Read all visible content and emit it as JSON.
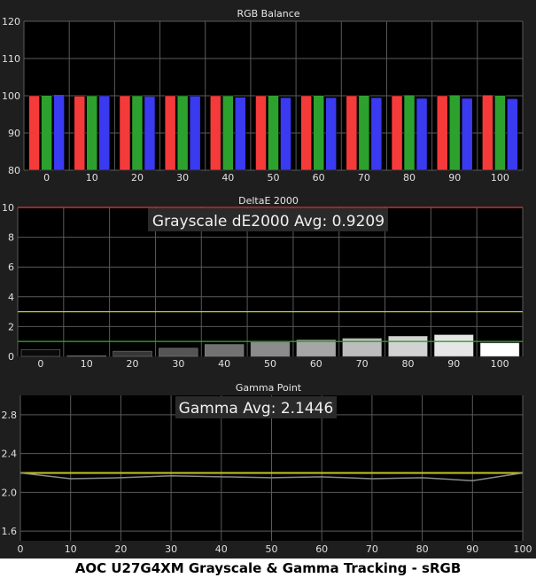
{
  "caption": "AOC U27G4XM Grayscale & Gamma Tracking - sRGB",
  "colors": {
    "red": "#f53a3a",
    "green": "#2da12d",
    "blue": "#3a3af0",
    "redline": "#e23a3a",
    "yellow": "#c8c81e",
    "greenline": "#2aa12a",
    "gamma_target": "#c8c81e",
    "gamma_measured": "#8a8a8a"
  },
  "chart_data": [
    {
      "type": "bar",
      "title": "RGB Balance",
      "categories": [
        "0",
        "10",
        "20",
        "30",
        "40",
        "50",
        "60",
        "70",
        "80",
        "90",
        "100"
      ],
      "series": [
        {
          "color": "red",
          "values": [
            100.0,
            99.9,
            100.0,
            100.0,
            100.0,
            100.0,
            100.0,
            100.0,
            100.0,
            100.0,
            100.2
          ]
        },
        {
          "color": "green",
          "values": [
            100.1,
            100.0,
            100.0,
            100.0,
            100.0,
            100.1,
            100.1,
            100.1,
            100.2,
            100.2,
            100.1
          ]
        },
        {
          "color": "blue",
          "values": [
            100.3,
            100.0,
            99.8,
            99.9,
            99.6,
            99.5,
            99.5,
            99.5,
            99.3,
            99.3,
            99.2
          ]
        }
      ],
      "ylim": [
        80,
        120
      ],
      "yticks": [
        80,
        90,
        100,
        110,
        120
      ],
      "grid": true
    },
    {
      "type": "bar",
      "title": "DeltaE 2000",
      "annotation": "Grayscale dE2000 Avg: 0.9209",
      "categories": [
        "0",
        "10",
        "20",
        "30",
        "40",
        "50",
        "60",
        "70",
        "80",
        "90",
        "100"
      ],
      "values": [
        0.45,
        0.05,
        0.35,
        0.55,
        0.8,
        0.95,
        1.1,
        1.2,
        1.35,
        1.45,
        0.9
      ],
      "bar_colors": [
        "#0a0a0a",
        "#1c1c1c",
        "#363636",
        "#555555",
        "#727272",
        "#8c8c8c",
        "#a6a6a6",
        "#bdbdbd",
        "#d2d2d2",
        "#e6e6e6",
        "#ffffff"
      ],
      "reference_lines": [
        10,
        3,
        1
      ],
      "ylim": [
        0,
        10
      ],
      "yticks": [
        0,
        2,
        4,
        6,
        8,
        10
      ],
      "grid": true
    },
    {
      "type": "line",
      "title": "Gamma Point",
      "annotation": "Gamma Avg: 2.1446",
      "x": [
        0,
        10,
        20,
        30,
        40,
        50,
        60,
        70,
        80,
        90,
        100
      ],
      "series": [
        {
          "role": "target",
          "values": [
            2.2,
            2.2,
            2.2,
            2.2,
            2.2,
            2.2,
            2.2,
            2.2,
            2.2,
            2.2,
            2.2
          ]
        },
        {
          "role": "measured",
          "values": [
            2.2,
            2.14,
            2.15,
            2.17,
            2.16,
            2.15,
            2.16,
            2.14,
            2.15,
            2.12,
            2.2
          ]
        }
      ],
      "ylim": [
        1.5,
        3.0
      ],
      "yticks": [
        1.6,
        2.0,
        2.4,
        2.8
      ],
      "xlim": [
        0,
        100
      ],
      "xticks": [
        0,
        10,
        20,
        30,
        40,
        50,
        60,
        70,
        80,
        90,
        100
      ],
      "grid": true
    }
  ]
}
